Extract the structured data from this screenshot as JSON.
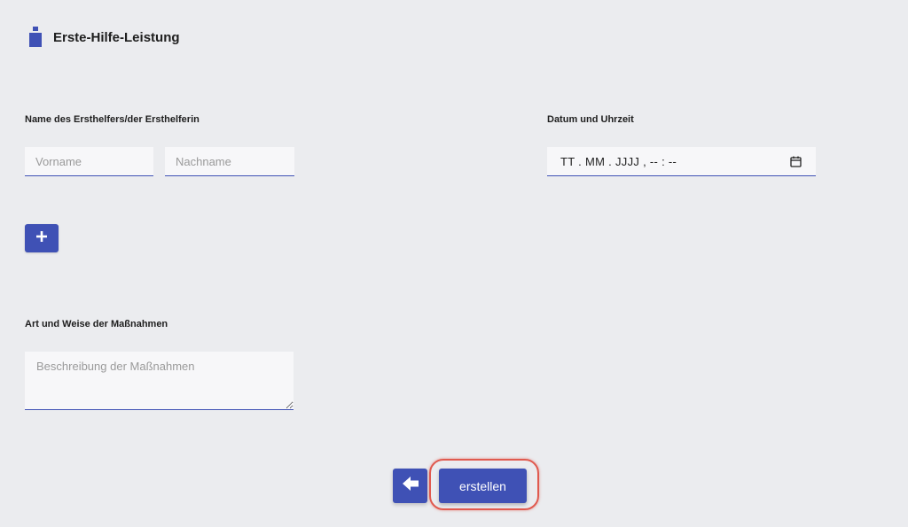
{
  "header": {
    "title": "Erste-Hilfe-Leistung",
    "icon": "first-aid-bottle-icon"
  },
  "first_aider": {
    "label": "Name des Ersthelfers/der Ersthelferin",
    "first_name_placeholder": "Vorname",
    "first_name_value": "",
    "last_name_placeholder": "Nachname",
    "last_name_value": ""
  },
  "datetime": {
    "label": "Datum und Uhrzeit",
    "value": "TT . MM . JJJJ ,  -- : --",
    "icon": "calendar-icon"
  },
  "add_button": {
    "icon": "plus-icon",
    "symbol": "+"
  },
  "measures": {
    "label": "Art und Weise der Maßnahmen",
    "placeholder": "Beschreibung der Maßnahmen",
    "value": ""
  },
  "footer": {
    "back_icon": "arrow-left-icon",
    "create_label": "erstellen"
  },
  "colors": {
    "accent": "#3f51b5",
    "background": "#ebecef",
    "input_bg": "#f7f7f9",
    "highlight": "#e05a4f"
  }
}
